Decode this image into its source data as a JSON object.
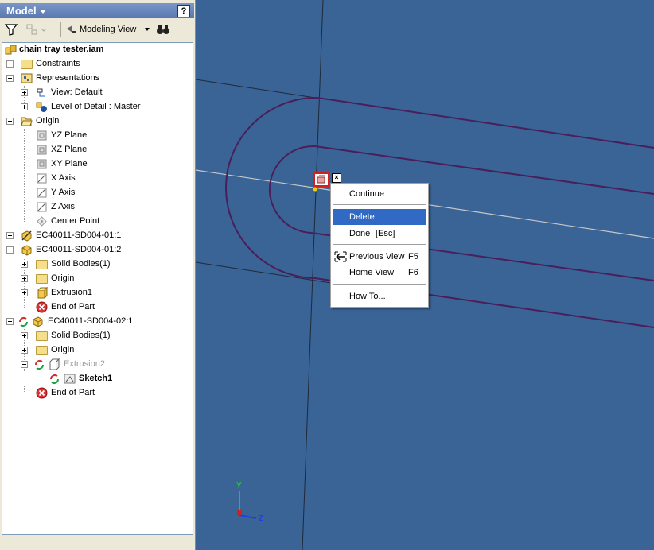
{
  "panel": {
    "title": "Model",
    "help_label": "?"
  },
  "toolbar": {
    "view_label": "Modeling View"
  },
  "tree": {
    "root": "chain tray tester.iam",
    "constraints": "Constraints",
    "representations": "Representations",
    "view": "View: Default",
    "lod": "Level of Detail : Master",
    "origin": "Origin",
    "yz": "YZ Plane",
    "xz": "XZ Plane",
    "xy": "XY Plane",
    "xaxis": "X Axis",
    "yaxis": "Y Axis",
    "zaxis": "Z Axis",
    "center": "Center Point",
    "comp1": "EC40011-SD004-01:1",
    "comp2": "EC40011-SD004-01:2",
    "solid1": "Solid Bodies(1)",
    "origin2": "Origin",
    "extrusion1": "Extrusion1",
    "eop1": "End of Part",
    "comp3": "EC40011-SD004-02:1",
    "solid2": "Solid Bodies(1)",
    "origin3": "Origin",
    "extrusion2": "Extrusion2",
    "sketch1": "Sketch1",
    "eop2": "End of Part"
  },
  "context_menu": {
    "continue": "Continue",
    "delete": "Delete",
    "done": "Done",
    "done_key": "[Esc]",
    "previous_view": "Previous View",
    "previous_key": "F5",
    "home_view": "Home View",
    "home_key": "F6",
    "how_to": "How To..."
  },
  "triad": {
    "y": "Y",
    "z": "Z"
  },
  "colors": {
    "viewport_bg": "#3a6396",
    "profile": "#4a1e5a",
    "highlight": "#316ac5"
  }
}
